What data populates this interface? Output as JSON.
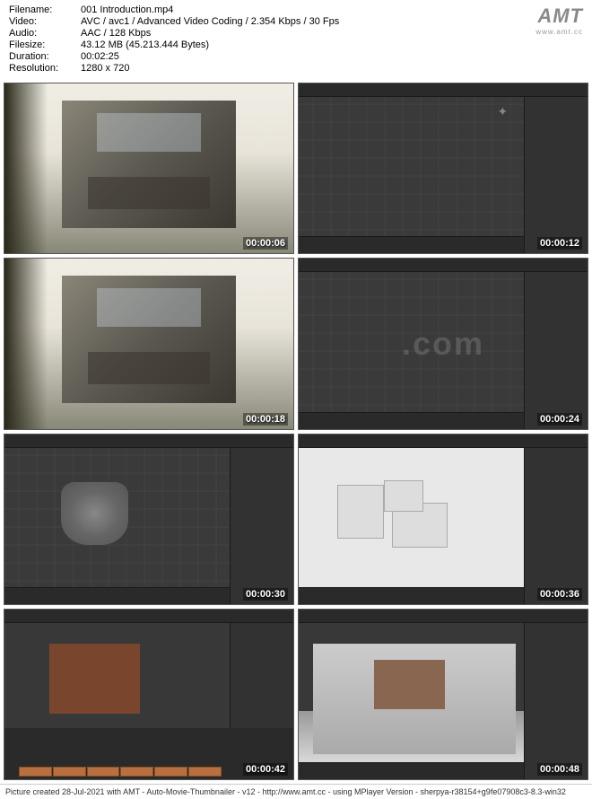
{
  "header": {
    "filename_label": "Filename:",
    "filename": "001 Introduction.mp4",
    "video_label": "Video:",
    "video": "AVC / avc1 / Advanced Video Coding / 2.354 Kbps / 30 Fps",
    "audio_label": "Audio:",
    "audio": "AAC / 128 Kbps",
    "filesize_label": "Filesize:",
    "filesize": "43.12 MB (45.213.444 Bytes)",
    "duration_label": "Duration:",
    "duration": "00:02:25",
    "resolution_label": "Resolution:",
    "resolution": "1280 x 720"
  },
  "logo": {
    "main": "AMT",
    "sub": "www.amt.cc"
  },
  "thumbnails": [
    {
      "time": "00:00:06"
    },
    {
      "time": "00:00:12"
    },
    {
      "time": "00:00:18"
    },
    {
      "time": "00:00:24"
    },
    {
      "time": "00:00:30"
    },
    {
      "time": "00:00:36"
    },
    {
      "time": "00:00:42"
    },
    {
      "time": "00:00:48"
    }
  ],
  "watermark": ".com",
  "footer": "Picture created 28-Jul-2021 with AMT - Auto-Movie-Thumbnailer - v12 - http://www.amt.cc - using MPlayer Version - sherpya-r38154+g9fe07908c3-8.3-win32"
}
